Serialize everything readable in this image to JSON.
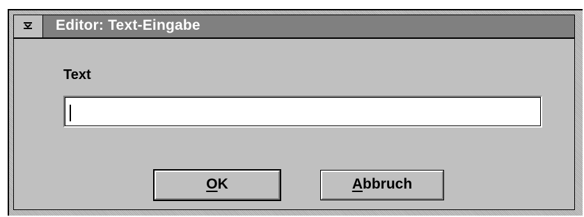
{
  "window": {
    "title": "Editor: Text-Eingabe",
    "system_menu_icon": "dash-menu-icon"
  },
  "form": {
    "label": "Text",
    "input_value": ""
  },
  "buttons": {
    "ok_mnemonic": "O",
    "ok_rest": "K",
    "cancel_mnemonic": "A",
    "cancel_rest": "bbruch"
  },
  "colors": {
    "titlebar": "#808080",
    "face": "#c0c0c0",
    "title_text": "#ffffff"
  }
}
